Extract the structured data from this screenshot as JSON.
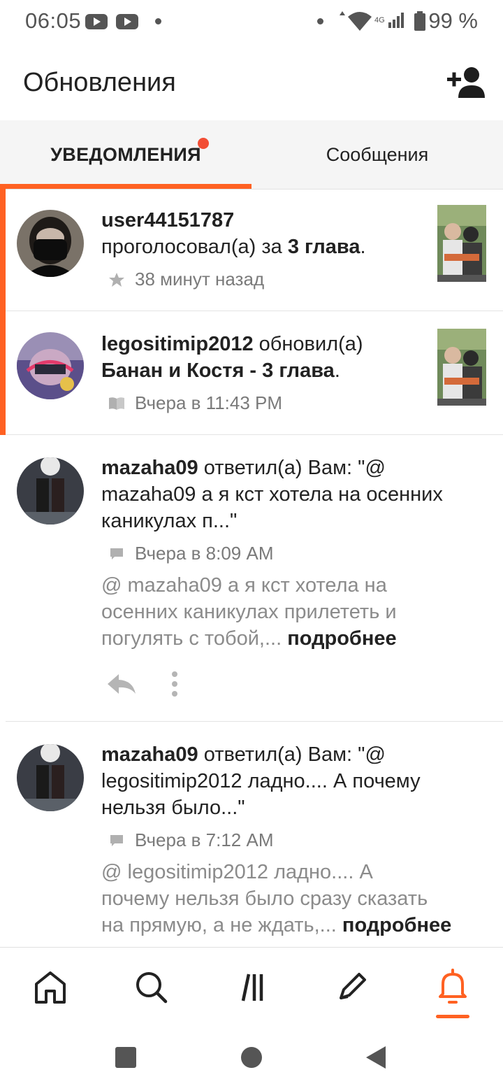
{
  "status_bar": {
    "time": "06:05",
    "battery": "99 %",
    "network": "4G"
  },
  "header": {
    "title": "Обновления"
  },
  "tabs": [
    {
      "label": "УВЕДОМЛЕНИЯ",
      "active": true,
      "has_badge": true
    },
    {
      "label": "Сообщения",
      "active": false
    }
  ],
  "notifications": [
    {
      "user": "user44151787",
      "action": "проголосовал(а) за",
      "target": "3 глава",
      "end": ".",
      "time": "38 минут назад",
      "icon": "star-icon"
    },
    {
      "user": "legositimip2012",
      "action": "обновил(а)",
      "target": "Банан и Костя - 3 глава",
      "end": ".",
      "time": "Вчера в 11:43 PM",
      "icon": "book-icon"
    },
    {
      "user": "mazaha09",
      "action_line1": "ответил(а) Вам: \"@",
      "action_line2": "mazaha09 а я кст хотела на осенних",
      "action_line3": "каникулах п...\"",
      "time": "Вчера в 8:09 AM",
      "icon": "comment-icon",
      "preview_line1": "@ mazaha09  а я кст хотела на",
      "preview_line2": "осенних каникулах прилететь и",
      "preview_line3": "погулять с тобой,...",
      "more": "подробнее"
    },
    {
      "user": "mazaha09",
      "action_line1": "ответил(а) Вам: \"@",
      "action_line2": "legositimip2012 ладно.... А почему",
      "action_line3": "нельзя было...\"",
      "time": "Вчера в 7:12 AM",
      "icon": "comment-icon",
      "preview_line1": "@ legositimip2012  ладно.... А",
      "preview_line2": "почему нельзя было сразу сказать",
      "preview_line3": "на прямую, а не ждать,...",
      "more": "подробнее"
    }
  ],
  "colors": {
    "accent": "#ff6122",
    "badge": "#f24e35",
    "muted": "#7a7a7a"
  }
}
